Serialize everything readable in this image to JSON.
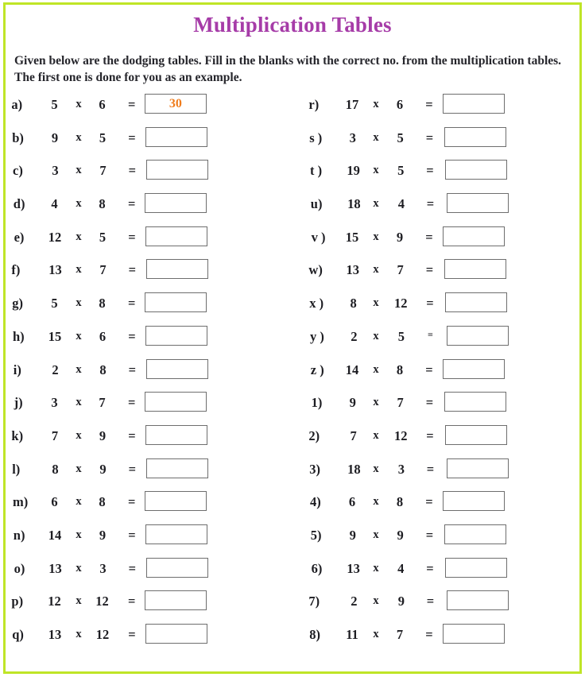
{
  "document": {
    "title": "Multiplication Tables",
    "instructions": "Given below are the dodging tables.  Fill in the blanks with the correct no. from the multiplication tables. The first one is done for you as an example.",
    "frame_color": "#bfe527",
    "title_color": "#a63ca8",
    "answer_color": "#ef7c1c",
    "box_border_color": "#6e6e6e",
    "times_symbol": "x",
    "equals_symbol": "=",
    "equals_symbol_small": "="
  },
  "columns": {
    "left": [
      {
        "label": "a)",
        "a": "5",
        "x": "x",
        "eq": "=",
        "b": "6",
        "answer": "30"
      },
      {
        "label": "b)",
        "a": "9",
        "x": "x",
        "eq": "=",
        "b": "5",
        "answer": ""
      },
      {
        "label": "c)",
        "a": "3",
        "x": "x",
        "eq": "=",
        "b": "7",
        "answer": ""
      },
      {
        "label": "d)",
        "a": "4",
        "x": "x",
        "eq": "=",
        "b": "8",
        "answer": ""
      },
      {
        "label": "e)",
        "a": "12",
        "x": "x",
        "eq": "=",
        "b": "5",
        "answer": ""
      },
      {
        "label": "f)",
        "a": "13",
        "x": "x",
        "eq": "=",
        "b": "7",
        "answer": ""
      },
      {
        "label": "g)",
        "a": "5",
        "x": "x",
        "eq": "=",
        "b": "8",
        "answer": ""
      },
      {
        "label": "h)",
        "a": "15",
        "x": "x",
        "eq": "=",
        "b": "6",
        "answer": ""
      },
      {
        "label": "i)",
        "a": "2",
        "x": "x",
        "eq": "=",
        "b": "8",
        "answer": ""
      },
      {
        "label": "j)",
        "a": "3",
        "x": "x",
        "eq": "=",
        "b": "7",
        "answer": ""
      },
      {
        "label": "k)",
        "a": "7",
        "x": "x",
        "eq": "=",
        "b": "9",
        "answer": ""
      },
      {
        "label": "l)",
        "a": "8",
        "x": "x",
        "eq": "=",
        "b": "9",
        "answer": ""
      },
      {
        "label": "m)",
        "a": "6",
        "x": "x",
        "eq": "=",
        "b": "8",
        "answer": ""
      },
      {
        "label": "n)",
        "a": "14",
        "x": "x",
        "eq": "=",
        "b": "9",
        "answer": ""
      },
      {
        "label": "o)",
        "a": "13",
        "x": "x",
        "eq": "=",
        "b": "3",
        "answer": ""
      },
      {
        "label": "p)",
        "a": "12",
        "x": "x",
        "eq": "=",
        "b": "12",
        "answer": ""
      },
      {
        "label": "q)",
        "a": "13",
        "x": "x",
        "eq": "=",
        "b": "12",
        "answer": ""
      }
    ],
    "right": [
      {
        "label": "r)",
        "a": "17",
        "x": "x",
        "eq": "=",
        "b": "6",
        "answer": ""
      },
      {
        "label": "s )",
        "a": "3",
        "x": "x",
        "eq": "=",
        "b": "5",
        "answer": ""
      },
      {
        "label": "t )",
        "a": "19",
        "x": "x",
        "eq": "=",
        "b": "5",
        "answer": ""
      },
      {
        "label": "u)",
        "a": "18",
        "x": "x",
        "eq": "=",
        "b": "4",
        "answer": ""
      },
      {
        "label": "v )",
        "a": "15",
        "x": "x",
        "eq": "=",
        "b": "9",
        "answer": ""
      },
      {
        "label": "w)",
        "a": "13",
        "x": "x",
        "eq": "=",
        "b": "7",
        "answer": ""
      },
      {
        "label": "x )",
        "a": "8",
        "x": "x",
        "eq": "=",
        "b": "12",
        "answer": ""
      },
      {
        "label": "y )",
        "a": "2",
        "x": "x",
        "eq": "=",
        "b": "5",
        "answer": ""
      },
      {
        "label": "z )",
        "a": "14",
        "x": "x",
        "eq": "=",
        "b": "8",
        "answer": ""
      },
      {
        "label": "1)",
        "a": "9",
        "x": "x",
        "eq": "=",
        "b": "7",
        "answer": ""
      },
      {
        "label": "2)",
        "a": "7",
        "x": "x",
        "eq": "=",
        "b": "12",
        "answer": ""
      },
      {
        "label": "3)",
        "a": "18",
        "x": "x",
        "eq": "=",
        "b": "3",
        "answer": ""
      },
      {
        "label": "4)",
        "a": "6",
        "x": "x",
        "eq": "=",
        "b": "8",
        "answer": ""
      },
      {
        "label": "5)",
        "a": "9",
        "x": "x",
        "eq": "=",
        "b": "9",
        "answer": ""
      },
      {
        "label": "6)",
        "a": "13",
        "x": "x",
        "eq": "=",
        "b": "4",
        "answer": ""
      },
      {
        "label": "7)",
        "a": "2",
        "x": "x",
        "eq": "=",
        "b": "9",
        "answer": ""
      },
      {
        "label": "8)",
        "a": "11",
        "x": "x",
        "eq": "=",
        "b": "7",
        "answer": ""
      }
    ]
  }
}
